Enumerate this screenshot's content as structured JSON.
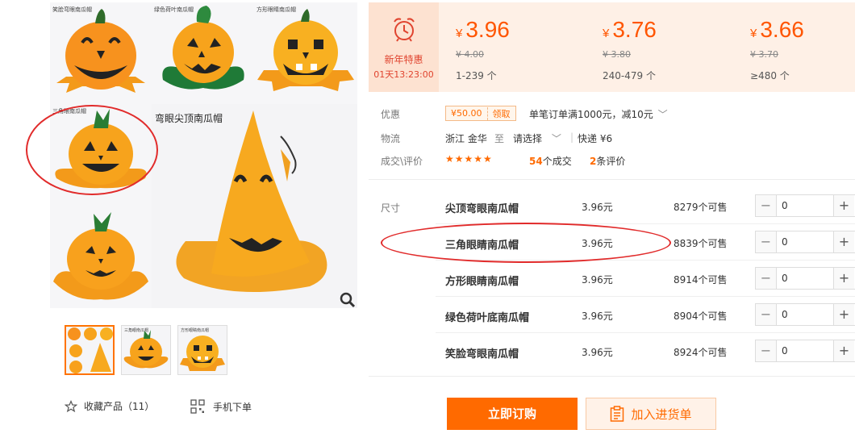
{
  "gallery": {
    "captions": {
      "smile": "笑脸弯眼南瓜帽",
      "leaf": "绿色荷叶南瓜帽",
      "square": "方形眼睛南瓜帽",
      "triangle": "三角眼南瓜帽",
      "pointed": "弯眼尖顶南瓜帽"
    },
    "thumb_captions": [
      "三角眼南瓜帽",
      "方形眼睛南瓜帽"
    ],
    "annotation_color": "#e12b2b"
  },
  "actions_left": {
    "favorite_label": "收藏产品（11）",
    "mobile_order_label": "手机下单"
  },
  "promo": {
    "title": "新年特惠",
    "countdown": "01天13:23:00"
  },
  "price_tiers": [
    {
      "currency": "¥",
      "price": "3.96",
      "original": "¥ 4.00",
      "range": "1-239 个"
    },
    {
      "currency": "¥",
      "price": "3.76",
      "original": "¥ 3.80",
      "range": "240-479 个"
    },
    {
      "currency": "¥",
      "price": "3.66",
      "original": "¥ 3.70",
      "range": "≥480 个"
    }
  ],
  "info": {
    "coupon_label": "优惠",
    "coupon_amount": "¥50.00",
    "coupon_get": "领取",
    "coupon_desc": "单笔订单满1000元，减10元",
    "logistics_label": "物流",
    "origin": "浙江 金华",
    "to": "至",
    "select": "请选择",
    "shipping": "快递 ¥6",
    "deals_label": "成交\\评价",
    "stars": "★★★★★",
    "deal_count": "54",
    "deal_suffix": "个成交",
    "review_count": "2",
    "review_suffix": "条评价"
  },
  "sku": {
    "size_label": "尺寸",
    "rows": [
      {
        "name": "尖顶弯眼南瓜帽",
        "price": "3.96元",
        "stock": "8279个可售",
        "qty": "0"
      },
      {
        "name": "三角眼睛南瓜帽",
        "price": "3.96元",
        "stock": "8839个可售",
        "qty": "0"
      },
      {
        "name": "方形眼睛南瓜帽",
        "price": "3.96元",
        "stock": "8914个可售",
        "qty": "0"
      },
      {
        "name": "绿色荷叶底南瓜帽",
        "price": "3.96元",
        "stock": "8904个可售",
        "qty": "0"
      },
      {
        "name": "笑脸弯眼南瓜帽",
        "price": "3.96元",
        "stock": "8924个可售",
        "qty": "0"
      }
    ]
  },
  "buttons": {
    "buy": "立即订购",
    "cart": "加入进货单"
  },
  "colors": {
    "accent": "#ff6a00",
    "price": "#ff5500",
    "promo_bg": "#fde2d1",
    "banner_bg": "#fef0e6",
    "pumpkin": "#f7a31c",
    "leaf": "#1f7a37"
  }
}
